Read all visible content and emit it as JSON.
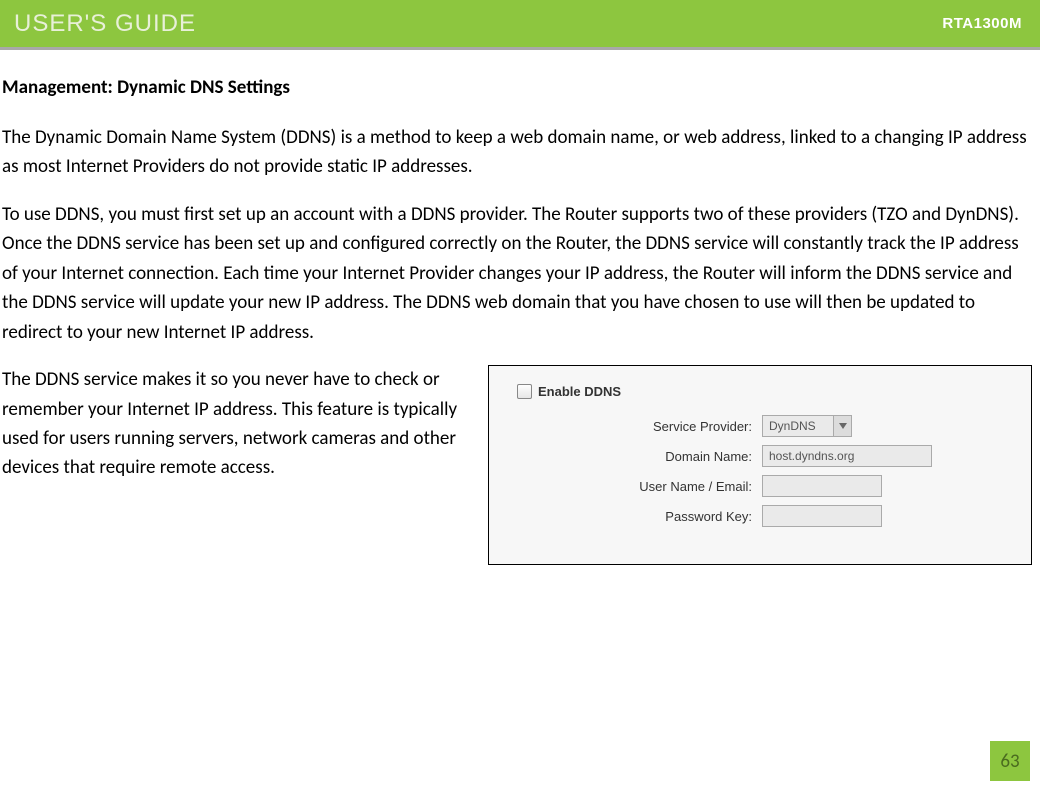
{
  "header": {
    "title": "USER'S GUIDE",
    "model": "RTA1300M"
  },
  "section_title": "Management: Dynamic DNS Settings",
  "para1": "The Dynamic Domain Name System (DDNS) is a method to keep a web domain name, or web address, linked to a changing IP address as most Internet Providers do not provide static IP addresses.",
  "para2": "To use DDNS, you must first set up an account with a DDNS provider. The Router supports two of these providers (TZO and DynDNS). Once the DDNS service has been set up and configured correctly on the Router, the DDNS service will constantly track the IP address of your Internet connection. Each time your Internet Provider changes your IP address, the Router will inform the DDNS service and the DDNS service will update your new IP address.  The DDNS web domain that you have chosen to use will then be updated to redirect to your new Internet IP address.",
  "para3": "The DDNS service makes it so you never have to check or remember your Internet IP address. This feature is typically used for users running servers, network cameras and other devices that require remote access.",
  "ddns_panel": {
    "enable_label": "Enable DDNS",
    "service_provider_label": "Service Provider:",
    "service_provider_value": "DynDNS",
    "domain_name_label": "Domain Name:",
    "domain_name_value": "host.dyndns.org",
    "user_name_label": "User Name / Email:",
    "password_label": "Password Key:"
  },
  "page_number": "63"
}
